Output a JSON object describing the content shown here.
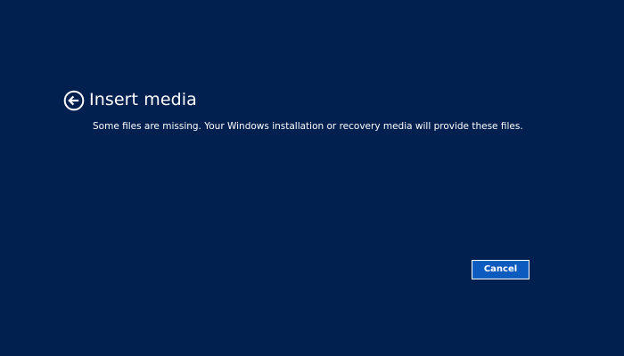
{
  "header": {
    "title": "Insert media",
    "back_icon": "back-arrow-circle-icon"
  },
  "main": {
    "message": "Some files are missing. Your Windows installation or recovery media will provide these files."
  },
  "footer": {
    "cancel_label": "Cancel"
  },
  "colors": {
    "background": "#012050",
    "button_fill": "#0e5bc0",
    "button_border": "#ffffff",
    "text": "#ffffff"
  }
}
